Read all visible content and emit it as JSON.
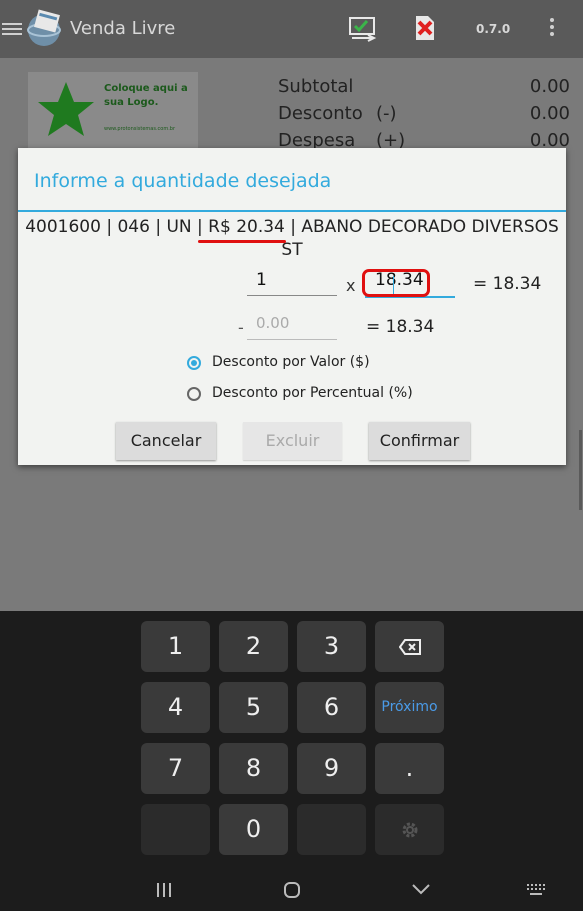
{
  "app": {
    "title": "Venda Livre",
    "version": "0.7.0",
    "logo_placeholder_text": "Coloque aqui a sua Logo.",
    "logo_url_text": "www.protonsistemas.com.br"
  },
  "totals": [
    {
      "label": "Subtotal",
      "sign": "",
      "value": "0.00"
    },
    {
      "label": "Desconto",
      "sign": "(-)",
      "value": "0.00"
    },
    {
      "label": "Despesa",
      "sign": "(+)",
      "value": "0.00"
    }
  ],
  "dialog": {
    "title": "Informe a quantidade desejada",
    "product_prefix": "4001600 | 046 | UN | ",
    "product_price": "R$ 20.34",
    "product_suffix": " | ABANO DECORADO DIVERSOS ST",
    "quantity_value": "1",
    "multiply_sign": "x",
    "unit_price_value": "18.34",
    "result_total": "= 18.34",
    "discount_sign": "-",
    "discount_placeholder": "0.00",
    "result_after_discount": "= 18.34",
    "radio_value_label": "Desconto por Valor ($)",
    "radio_percent_label": "Desconto por Percentual (%)",
    "cancel_label": "Cancelar",
    "delete_label": "Excluir",
    "confirm_label": "Confirmar"
  },
  "keyboard": {
    "keys": [
      "1",
      "2",
      "3",
      "4",
      "5",
      "6",
      "7",
      "8",
      "9",
      ".",
      "0"
    ],
    "next_label": "Próximo"
  },
  "colors": {
    "accent": "#33aadd",
    "highlight": "#e01010"
  }
}
